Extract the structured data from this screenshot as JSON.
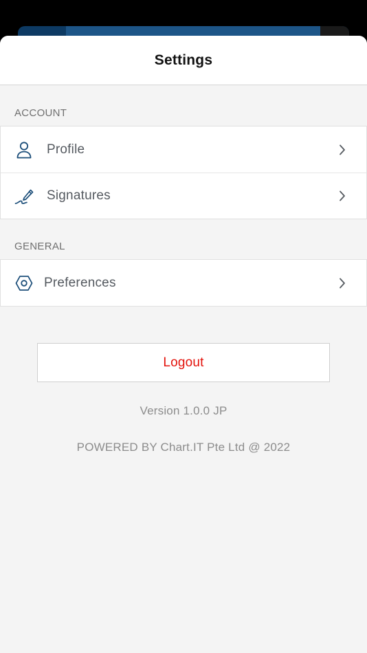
{
  "header": {
    "title": "Settings"
  },
  "sections": {
    "account": {
      "label": "ACCOUNT",
      "items": [
        {
          "label": "Profile",
          "icon": "person-icon"
        },
        {
          "label": "Signatures",
          "icon": "pen-signature-icon"
        }
      ]
    },
    "general": {
      "label": "GENERAL",
      "items": [
        {
          "label": "Preferences",
          "icon": "hexagon-gear-icon"
        }
      ]
    }
  },
  "logout": {
    "label": "Logout"
  },
  "footer": {
    "version": "Version 1.0.0 JP",
    "powered": "POWERED BY Chart.IT Pte Ltd @ 2022"
  },
  "colors": {
    "accent_icon": "#1d4f7a",
    "logout_text": "#e3120b",
    "muted_text": "#8c8c8c",
    "background": "#f4f4f4",
    "backdrop_bar": "#1d5587"
  }
}
